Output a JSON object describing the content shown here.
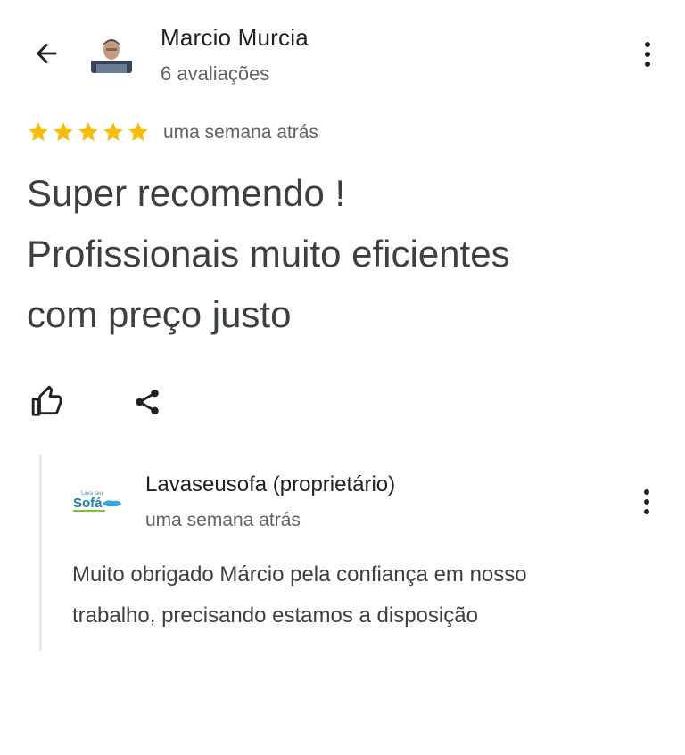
{
  "header": {
    "reviewer_name": "Marcio Murcia",
    "review_count": "6 avaliações",
    "back_icon": "arrow-back-icon",
    "more_icon": "more-vert-icon"
  },
  "review": {
    "rating": 5,
    "max_rating": 5,
    "star_color": "#FBBC04",
    "time": "uma semana atrás",
    "text_line1": "Super recomendo !",
    "text_line2": "Profissionais muito eficientes",
    "text_line3": "com preço justo"
  },
  "actions": {
    "like_icon": "thumb-up-icon",
    "share_icon": "share-icon"
  },
  "owner_reply": {
    "logo_text_top": "Lava seu",
    "logo_text_main": "Sofá",
    "owner_name": "Lavaseusofa (proprietário)",
    "time": "uma semana atrás",
    "text_line1": "Muito obrigado  Márcio pela confiança  em nosso",
    "text_line2": "trabalho,  precisando  estamos  a disposição"
  }
}
